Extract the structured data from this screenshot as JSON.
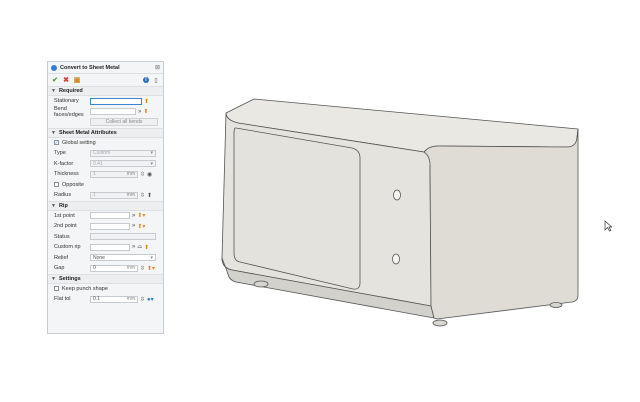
{
  "dialog": {
    "title": "Convert to Sheet Metal",
    "close_glyph": "⊠",
    "toolbar": {
      "ok": "✔",
      "cancel": "✖",
      "save": "▣",
      "info": "i",
      "more": "▯"
    }
  },
  "sections": {
    "required": {
      "title": "Required",
      "stationary_label": "Stationary",
      "stationary_value": "",
      "bend_label": "Bend faces/edges",
      "bend_value": "",
      "collect_label": "Collect all bends"
    },
    "attributes": {
      "title": "Sheet Metal Attributes",
      "global_label": "Global setting",
      "global_checked": true,
      "type_label": "Type",
      "type_value": "Custom",
      "kfactor_label": "K-factor",
      "kfactor_value": "0.41",
      "thickness_label": "Thickness",
      "thickness_value": "1",
      "thickness_unit": "mm",
      "opposite_label": "Opposite",
      "opposite_checked": false,
      "radius_label": "Radius",
      "radius_value": "1",
      "radius_unit": "mm"
    },
    "rip": {
      "title": "Rip",
      "first_label": "1st point",
      "first_value": "",
      "second_label": "2nd point",
      "second_value": "",
      "status_label": "Status",
      "status_value": "",
      "custom_label": "Custom rip",
      "custom_value": "",
      "relief_label": "Relief",
      "relief_value": "None",
      "gap_label": "Gap",
      "gap_value": "0",
      "gap_unit": "mm"
    },
    "settings": {
      "title": "Settings",
      "keep_label": "Keep punch shape",
      "keep_checked": false,
      "flat_label": "Flat tol",
      "flat_value": "0.1",
      "flat_unit": "mm"
    }
  },
  "colors": {
    "accent": "#2f7fd0",
    "model_face": "#e8e6e0",
    "model_edge": "#555555"
  }
}
